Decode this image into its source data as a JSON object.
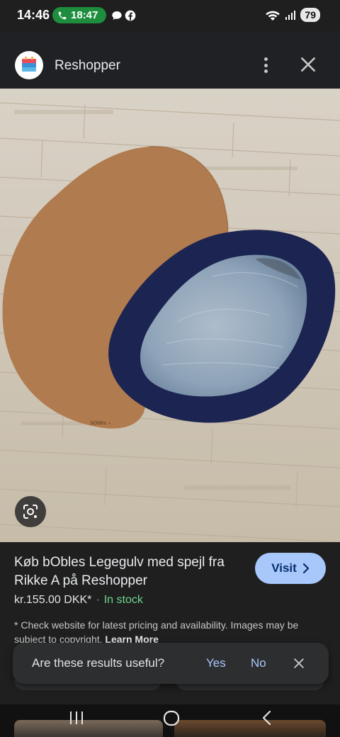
{
  "status_bar": {
    "time": "14:46",
    "call_timer": "18:47",
    "battery": "79",
    "icons": [
      "phone-icon",
      "chat-bubble-icon",
      "facebook-icon",
      "wifi-icon",
      "signal-icon"
    ]
  },
  "header": {
    "site_name": "Reshopper",
    "logo_icon": "cake-logo-icon",
    "more_icon": "more-vert-icon",
    "close_icon": "close-icon"
  },
  "image": {
    "alt_icon": "lens-search-icon",
    "mat_mark": "bObles"
  },
  "product": {
    "title": "Køb bObles Legegulv med spejl fra Rikke A på Reshopper",
    "visit_label": "Visit",
    "price": "kr.155.00 DKK*",
    "separator": "·",
    "stock": "In stock",
    "disclaimer": "* Check website for latest pricing and availability. Images may be subject to copyright.",
    "learn_more": "Learn More"
  },
  "feedback": {
    "question": "Are these results useful?",
    "yes": "Yes",
    "no": "No"
  },
  "colors": {
    "accent": "#a8c7fa",
    "in_stock": "#6dd58c",
    "call_green": "#1e8e3e",
    "background": "#1f1f1f"
  }
}
